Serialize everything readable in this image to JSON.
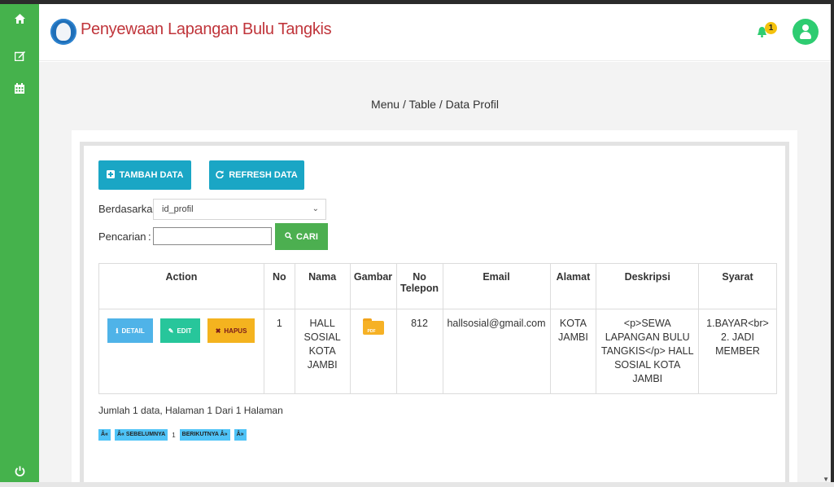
{
  "app": {
    "title": "Penyewaan Lapangan Bulu Tangkis",
    "notification_count": "1"
  },
  "breadcrumb": "Menu / Table / Data Profil",
  "toolbar": {
    "tambah_label": "TAMBAH DATA",
    "refresh_label": "REFRESH DATA"
  },
  "filter": {
    "berdasarkan_label": "Berdasarkan:",
    "berdasarkan_value": "id_profil",
    "pencarian_label": "Pencarian",
    "search_value": "",
    "cari_label": "CARI"
  },
  "table": {
    "headers": [
      "Action",
      "No",
      "Nama",
      "Gambar",
      "No Telepon",
      "Email",
      "Alamat",
      "Deskripsi",
      "Syarat"
    ],
    "rows": [
      {
        "no": "1",
        "nama": "HALL SOSIAL KOTA JAMBI",
        "gambar": "PDF",
        "telepon": "812",
        "email": "hallsosial@gmail.com",
        "alamat": "KOTA JAMBI",
        "deskripsi": "<p>SEWA LAPANGAN BULU TANGKIS</p> HALL SOSIAL KOTA JAMBI",
        "syarat": "1.BAYAR<br> 2. JADI MEMBER",
        "actions": {
          "detail": "DETAIL",
          "edit": "EDIT",
          "hapus": "HAPUS"
        }
      }
    ]
  },
  "summary": "Jumlah 1 data, Halaman 1 Dari 1 Halaman",
  "pagination": {
    "first": "Â«",
    "prev": "Â« SEBELUMNYA",
    "current": "1",
    "next": "BERIKUTNYA Â»",
    "last": "Â»"
  },
  "colors": {
    "sidebar": "#45b24c",
    "title": "#c0353b",
    "info": "#1aa6c5",
    "success": "#4caf50",
    "warning": "#f4b31f"
  },
  "icons": [
    "home-icon",
    "edit-icon",
    "calendar-icon",
    "power-icon",
    "bell-icon",
    "user-icon",
    "plus-icon",
    "refresh-icon",
    "search-icon",
    "info-icon",
    "pencil-icon",
    "x-icon",
    "folder-icon"
  ]
}
